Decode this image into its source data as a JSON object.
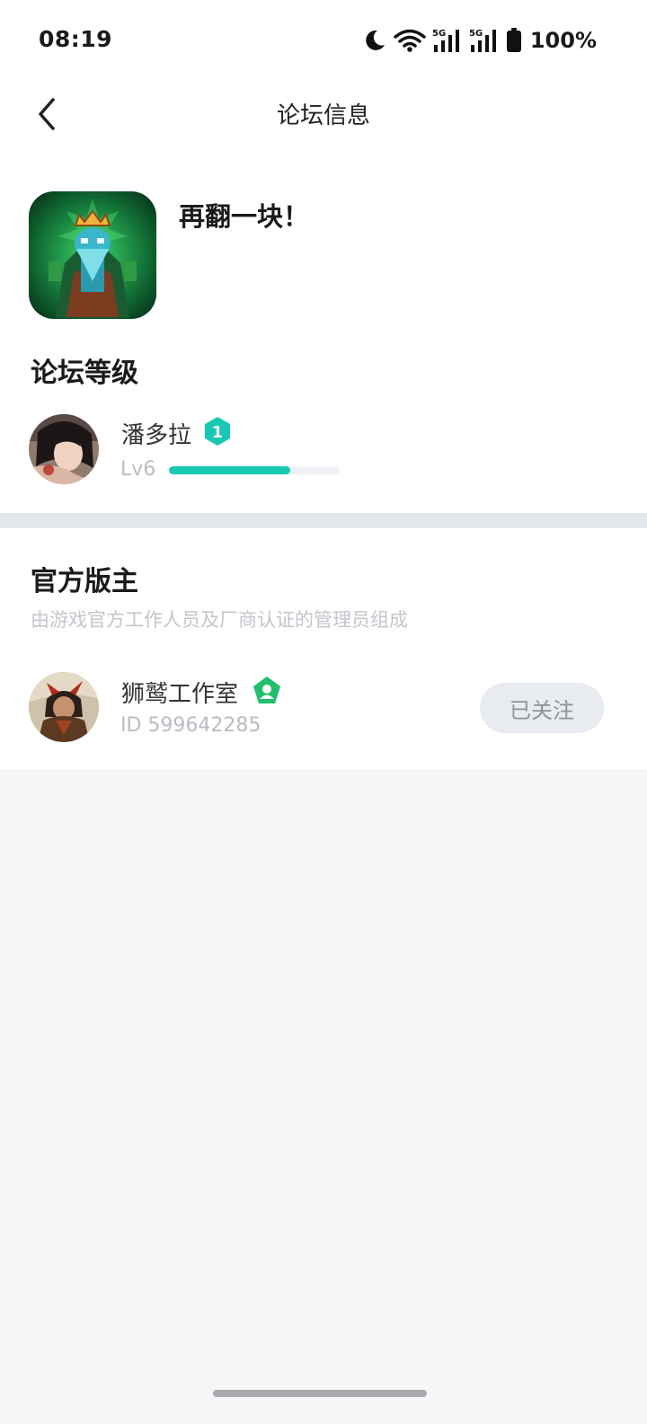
{
  "status_bar": {
    "time": "08:19",
    "signal1_label": "5G",
    "signal2_label": "5G",
    "battery": "100%",
    "icons": [
      "moon-icon",
      "wifi-icon",
      "signal-5g-icon",
      "signal-5g-icon",
      "battery-icon"
    ]
  },
  "header": {
    "title": "论坛信息",
    "back_icon": "chevron-left-icon"
  },
  "forum": {
    "name": "再翻一块！"
  },
  "level_section": {
    "title": "论坛等级",
    "user_name": "潘多拉",
    "badge_text": "1",
    "level_label": "Lv6",
    "progress": 0.71,
    "accent_color": "#17c9b3"
  },
  "moderator_section": {
    "title": "官方版主",
    "subtitle": "由游戏官方工作人员及厂商认证的管理员组成",
    "moderator": {
      "name": "狮鹫工作室",
      "id_text": "ID 599642285",
      "follow_label": "已关注",
      "badge_color": "#1fbf6c"
    }
  }
}
